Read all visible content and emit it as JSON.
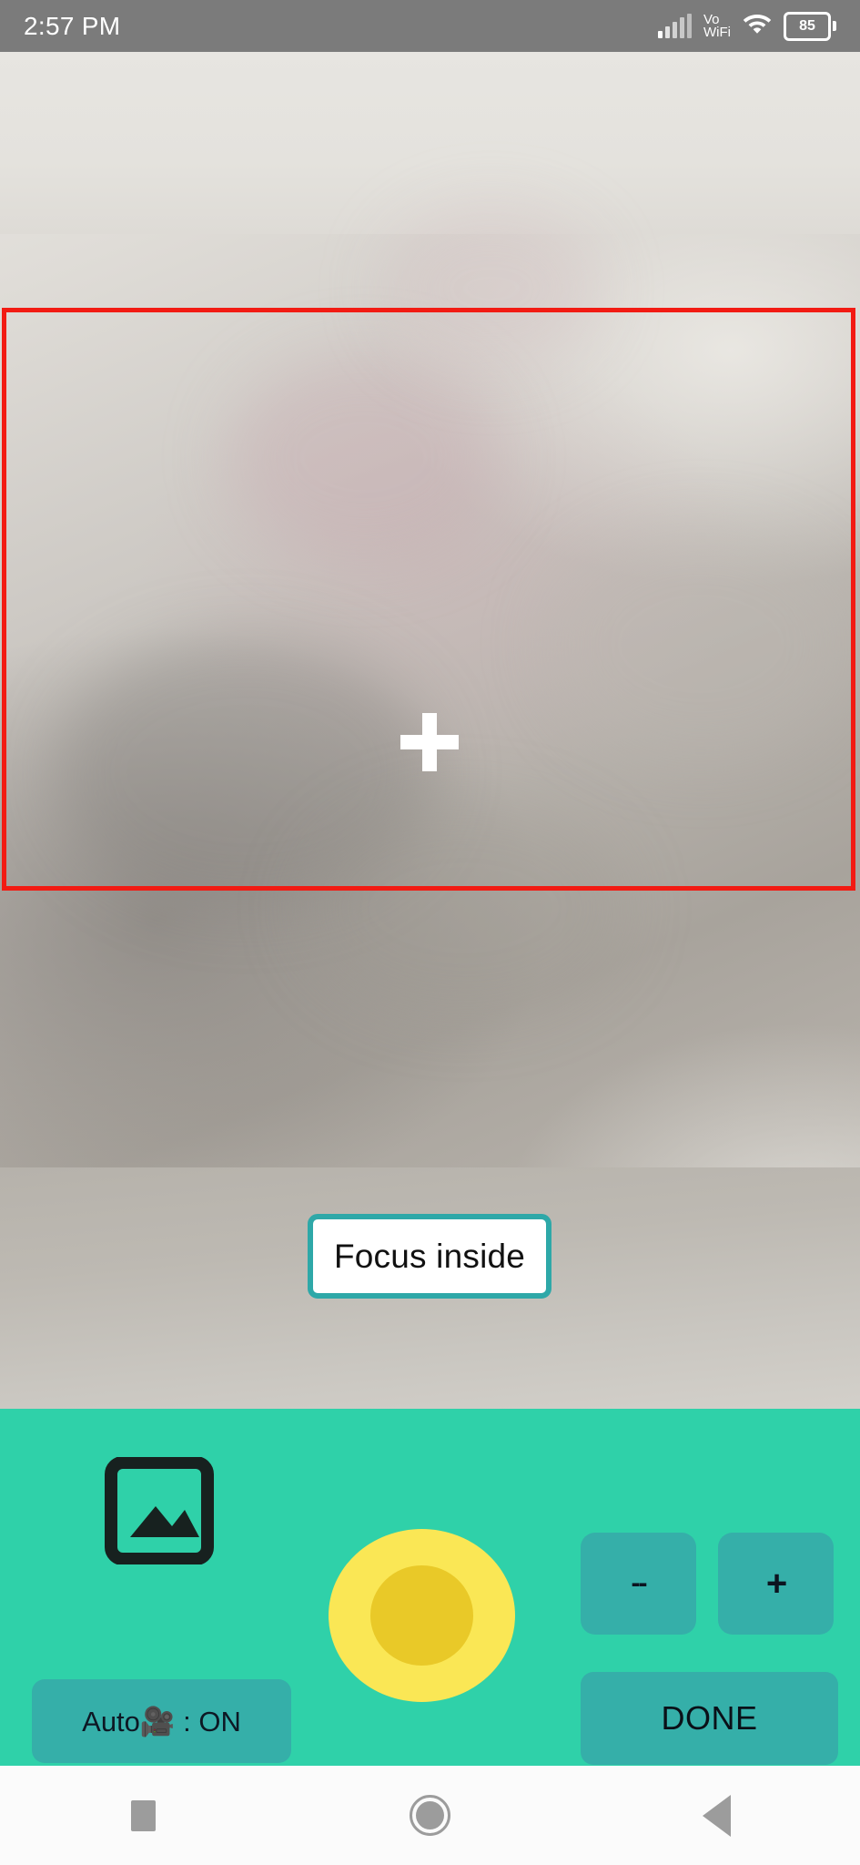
{
  "status_bar": {
    "clock": "2:57 PM",
    "network_label_line1": "Vo",
    "network_label_line2": "WiFi",
    "battery_level": "85",
    "icons": [
      "signal-bars-icon",
      "volte-wifi-icon",
      "wifi-icon",
      "battery-icon"
    ]
  },
  "camera": {
    "roi_color": "#f21b13",
    "focus_marker": "crosshair-plus-icon",
    "hint_button_label": "Focus inside",
    "hint_button_border_color": "#2ea8a8",
    "hint_button_bg": "#ffffff"
  },
  "control_panel": {
    "background_color": "#2fd1a9",
    "button_color": "#35afa9",
    "gallery_icon": "gallery-image-icon",
    "shutter": {
      "outer_color": "#fae755",
      "inner_color": "#e9c928",
      "name": "shutter-button"
    },
    "zoom_out_label": "--",
    "zoom_in_label": "+",
    "auto_mode_label": "Auto🎥 : ON",
    "done_label": "DONE"
  },
  "nav_bar": {
    "recents_label": "recents",
    "home_label": "home",
    "back_label": "back"
  }
}
